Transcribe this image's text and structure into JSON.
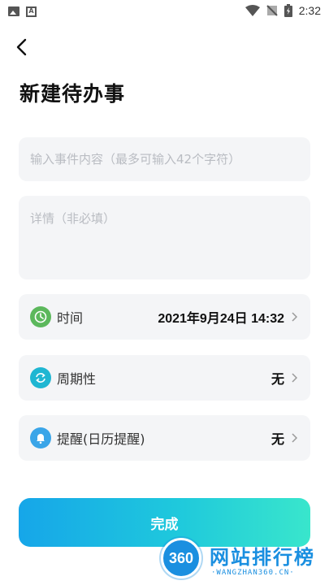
{
  "status_bar": {
    "time": "2:32",
    "left_icons": [
      "image-icon",
      "a-icon"
    ],
    "right_icons": [
      "wifi-icon",
      "no-signal-icon",
      "battery-icon"
    ]
  },
  "header": {
    "back_icon": "chevron-left-icon",
    "title": "新建待办事"
  },
  "form": {
    "event_placeholder": "输入事件内容（最多可输入42个字符）",
    "event_value": "",
    "detail_placeholder": "详情（非必填）",
    "detail_value": ""
  },
  "settings": [
    {
      "label": "时间",
      "value": "2021年9月24日 14:32",
      "icon": "clock-icon",
      "icon_color": "#5cb85c"
    },
    {
      "label": "周期性",
      "value": "无",
      "icon": "repeat-icon",
      "icon_color": "#1fb6d2"
    },
    {
      "label": "提醒(日历提醒)",
      "value": "无",
      "icon": "bell-icon",
      "icon_color": "#3aa5e8"
    }
  ],
  "done_button": {
    "label": "完成",
    "gradient_start": "#16a6e9",
    "gradient_end": "#39e6cc"
  },
  "watermark": {
    "badge": "360",
    "title": "网站排行榜",
    "subtitle": "·WANGZHAN360.CN·"
  }
}
